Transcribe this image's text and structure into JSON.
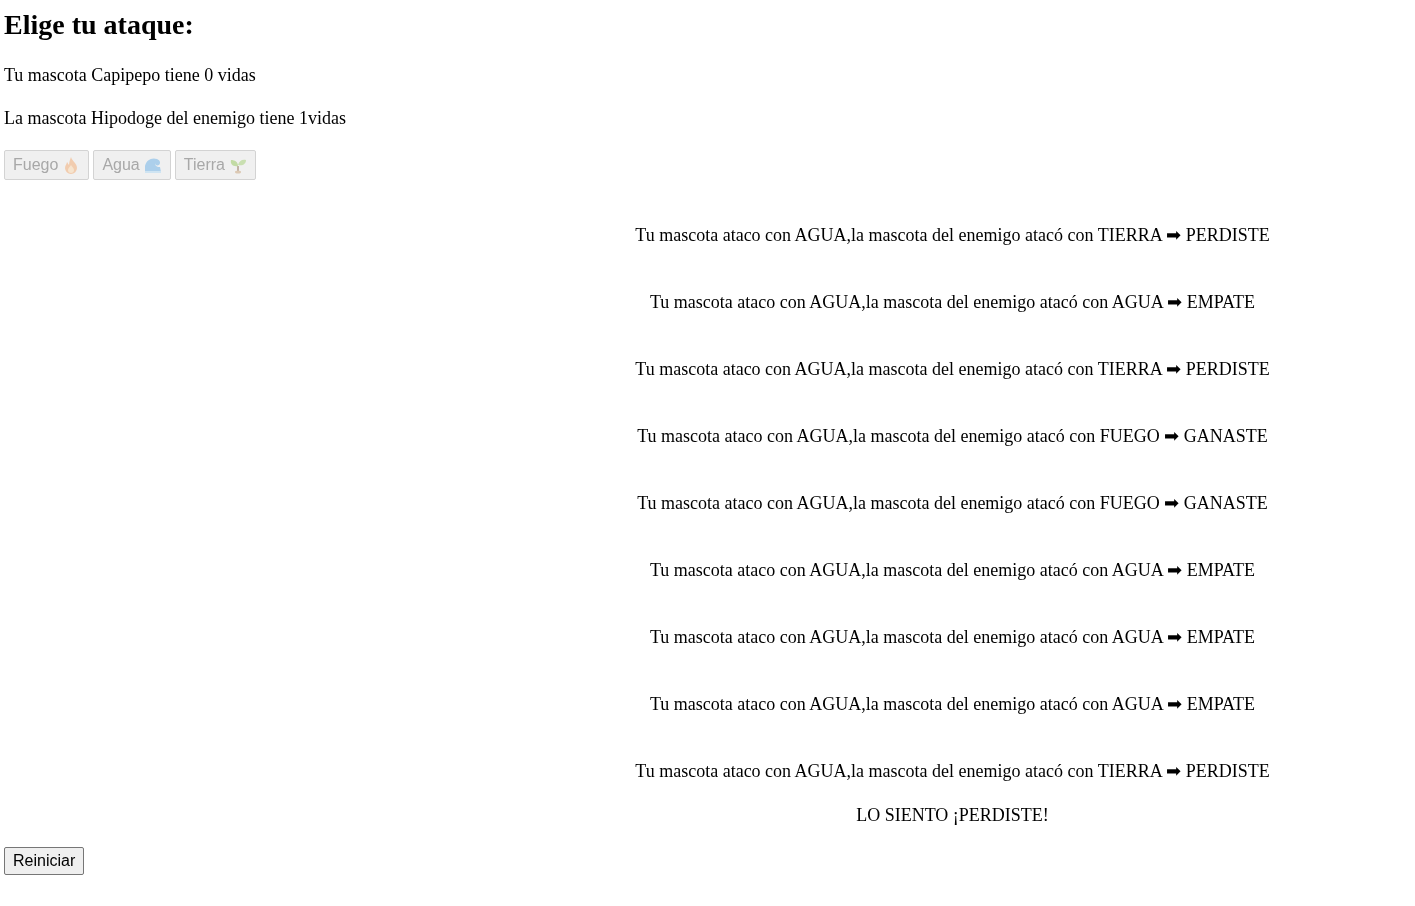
{
  "title": "Elige tu ataque:",
  "player_status": "Tu mascota Capipepo tiene 0 vidas",
  "enemy_status": "La mascota Hipodoge del enemigo tiene 1vidas",
  "attack_buttons": [
    {
      "label": "Fuego",
      "kind": "fire",
      "disabled": true
    },
    {
      "label": "Agua",
      "kind": "water",
      "disabled": true
    },
    {
      "label": "Tierra",
      "kind": "earth",
      "disabled": true
    }
  ],
  "messages": [
    "Tu mascota ataco con AGUA,la mascota del enemigo atacó con TIERRA ➡ PERDISTE",
    "Tu mascota ataco con AGUA,la mascota del enemigo atacó con AGUA ➡ EMPATE",
    "Tu mascota ataco con AGUA,la mascota del enemigo atacó con TIERRA ➡ PERDISTE",
    "Tu mascota ataco con AGUA,la mascota del enemigo atacó con FUEGO ➡ GANASTE",
    "Tu mascota ataco con AGUA,la mascota del enemigo atacó con FUEGO ➡ GANASTE",
    "Tu mascota ataco con AGUA,la mascota del enemigo atacó con AGUA ➡ EMPATE",
    "Tu mascota ataco con AGUA,la mascota del enemigo atacó con AGUA ➡ EMPATE",
    "Tu mascota ataco con AGUA,la mascota del enemigo atacó con AGUA ➡ EMPATE",
    "Tu mascota ataco con AGUA,la mascota del enemigo atacó con TIERRA ➡ PERDISTE"
  ],
  "result": "LO SIENTO ¡PERDISTE!",
  "restart_button": {
    "label": "Reiniciar",
    "disabled": false
  }
}
